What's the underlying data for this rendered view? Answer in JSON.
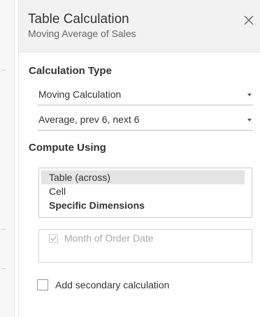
{
  "header": {
    "title": "Table Calculation",
    "subtitle": "Moving Average of Sales",
    "close_icon": "close-icon"
  },
  "calculation_type": {
    "heading": "Calculation Type",
    "type_value": "Moving Calculation",
    "summary_value": "Average, prev 6, next 6"
  },
  "compute_using": {
    "heading": "Compute Using",
    "options": [
      {
        "label": "Table (across)",
        "selected": true,
        "bold": false
      },
      {
        "label": "Cell",
        "selected": false,
        "bold": false
      },
      {
        "label": "Specific Dimensions",
        "selected": false,
        "bold": true
      }
    ],
    "dimensions": [
      {
        "label": "Month of Order Date",
        "checked": true,
        "enabled": false
      }
    ]
  },
  "secondary": {
    "label": "Add secondary calculation",
    "checked": false
  },
  "colors": {
    "header_bg": "#f2f2f2",
    "selected_bg": "#e4e4e4",
    "text": "#333333",
    "muted_text": "#a9a9a9"
  }
}
